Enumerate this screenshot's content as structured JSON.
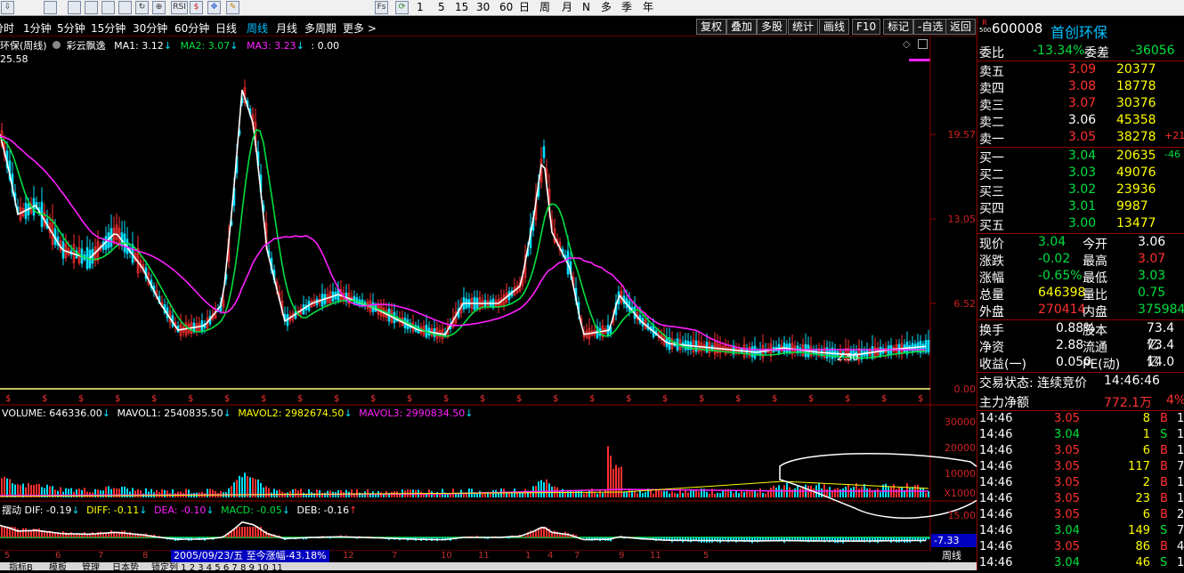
{
  "toolbar": {
    "period_buttons": [
      "1",
      "5",
      "15",
      "30",
      "60",
      "日",
      "周",
      "月",
      "N",
      "多",
      "季",
      "年"
    ],
    "icons": [
      "arrow-down-icon",
      "bar-chart-icon",
      "candlestick-icon",
      "kline-icon",
      "fund-flow-icon",
      "distribution-icon",
      "reload-icon",
      "zoom-icon",
      "rsi-icon",
      "s-icon",
      "move-icon",
      "pencil-icon",
      "fs-icon",
      "refresh-icon"
    ],
    "rsi_label": "RSI",
    "fs_label": "Fs"
  },
  "period_bar": {
    "items": [
      "分时",
      "1分钟",
      "5分钟",
      "15分钟",
      "30分钟",
      "60分钟",
      "日线",
      "周线",
      "月线",
      "多周期",
      "更多 >"
    ],
    "active": "周线",
    "right_buttons": [
      "复权",
      "叠加",
      "多股",
      "统计",
      "画线",
      "F10",
      "标记",
      "-自选",
      "返回"
    ]
  },
  "main_chart": {
    "title": "环保(周线)",
    "indicator": "彩云飘逸",
    "ma1": "MA1: 3.12",
    "ma2": "MA2: 3.07",
    "ma3": "MA3: 3.23",
    "extra": ": 0.00",
    "top_value": "25.58",
    "y_ticks": [
      "19.57",
      "13.05",
      "6.52",
      "0.00"
    ],
    "annotation": "2.50",
    "colors": {
      "up": "#ff3030",
      "down": "#00e0ff",
      "ma1": "#ffffff",
      "ma2": "#00e040",
      "ma3": "#ff20ff"
    }
  },
  "volume": {
    "label": "VOLUME: 646336.00",
    "mavol1": "MAVOL1: 2540835.50",
    "mavol2": "MAVOL2: 2982674.50",
    "mavol3": "MAVOL3: 2990834.50",
    "y_ticks": [
      "30000",
      "20000",
      "10000"
    ],
    "unit": "X1000"
  },
  "macd": {
    "label": "摆动",
    "dif": "DIF: -0.19",
    "diff": "DIFF: -0.11",
    "dea": "DEA: -0.10",
    "macd": "MACD: -0.05",
    "deb": "DEB: -0.16",
    "y_tick": "15.00",
    "current": "-7.33"
  },
  "bottom": {
    "date_info": "2005/09/23/五 至今涨幅-43.18%",
    "period_label": "周线",
    "month_ticks": [
      "5",
      "6",
      "7",
      "8",
      "9",
      "10",
      "11",
      "12",
      "7",
      "10",
      "11",
      "1",
      "4",
      "7",
      "9",
      "11",
      "5"
    ],
    "tabs": [
      "指标B",
      "模板",
      "管理",
      "日本势",
      "锁定列 1 2 3 4 5 6 7 8 9 10 11"
    ]
  },
  "quote": {
    "r_label": "R",
    "num_label": "500",
    "code": "600008",
    "name": "首创环保",
    "weibi_label": "委比",
    "weibi": "-13.34%",
    "weicha_label": "委差",
    "weicha": "-36056",
    "asks": [
      {
        "label": "卖五",
        "price": "3.09",
        "vol": "20377",
        "chg": ""
      },
      {
        "label": "卖四",
        "price": "3.08",
        "vol": "18778",
        "chg": ""
      },
      {
        "label": "卖三",
        "price": "3.07",
        "vol": "30376",
        "chg": ""
      },
      {
        "label": "卖二",
        "price": "3.06",
        "vol": "45358",
        "chg": ""
      },
      {
        "label": "卖一",
        "price": "3.05",
        "vol": "38278",
        "chg": "+21"
      }
    ],
    "bids": [
      {
        "label": "买一",
        "price": "3.04",
        "vol": "20635",
        "chg": "-46"
      },
      {
        "label": "买二",
        "price": "3.03",
        "vol": "49076",
        "chg": ""
      },
      {
        "label": "买三",
        "price": "3.02",
        "vol": "23936",
        "chg": ""
      },
      {
        "label": "买四",
        "price": "3.01",
        "vol": "9987",
        "chg": ""
      },
      {
        "label": "买五",
        "price": "3.00",
        "vol": "13477",
        "chg": ""
      }
    ],
    "stats": [
      {
        "l1": "现价",
        "v1": "3.04",
        "l2": "今开",
        "v2": "3.06"
      },
      {
        "l1": "涨跌",
        "v1": "-0.02",
        "l2": "最高",
        "v2": "3.07"
      },
      {
        "l1": "涨幅",
        "v1": "-0.65%",
        "l2": "最低",
        "v2": "3.03"
      },
      {
        "l1": "总量",
        "v1": "646398",
        "l2": "量比",
        "v2": "0.75"
      },
      {
        "l1": "外盘",
        "v1": "270414",
        "l2": "内盘",
        "v2": "375984"
      }
    ],
    "stats2": [
      {
        "l1": "换手",
        "v1": "0.88%",
        "l2": "股本",
        "v2": "73.4亿"
      },
      {
        "l1": "净资",
        "v1": "2.88",
        "l2": "流通",
        "v2": "73.4亿"
      },
      {
        "l1": "收益(一)",
        "v1": "0.050",
        "l2": "PE(动)",
        "v2": "14.0"
      }
    ],
    "status_label": "交易状态: 连续竞价",
    "status_time": "14:46:46",
    "mainflow_label": "主力净额",
    "mainflow": "772.1万",
    "mainflow_pct": "4%",
    "ticks": [
      {
        "t": "14:46",
        "p": "3.05",
        "v": "8",
        "s": "B",
        "n": "1"
      },
      {
        "t": "14:46",
        "p": "3.04",
        "v": "1",
        "s": "S",
        "n": "1"
      },
      {
        "t": "14:46",
        "p": "3.05",
        "v": "6",
        "s": "B",
        "n": "1"
      },
      {
        "t": "14:46",
        "p": "3.05",
        "v": "117",
        "s": "B",
        "n": "7"
      },
      {
        "t": "14:46",
        "p": "3.05",
        "v": "2",
        "s": "B",
        "n": "1"
      },
      {
        "t": "14:46",
        "p": "3.05",
        "v": "23",
        "s": "B",
        "n": "1"
      },
      {
        "t": "14:46",
        "p": "3.05",
        "v": "6",
        "s": "B",
        "n": "2"
      },
      {
        "t": "14:46",
        "p": "3.04",
        "v": "149",
        "s": "S",
        "n": "7"
      },
      {
        "t": "14:46",
        "p": "3.05",
        "v": "86",
        "s": "B",
        "n": "4"
      },
      {
        "t": "14:46",
        "p": "3.04",
        "v": "46",
        "s": "S",
        "n": "1"
      }
    ]
  }
}
